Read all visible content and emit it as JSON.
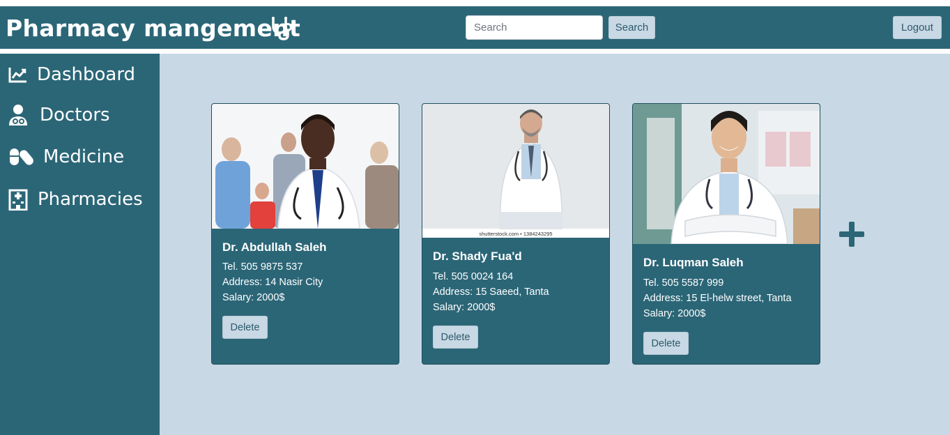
{
  "header": {
    "title": "Pharmacy mangement",
    "brand_icon": "stethoscope-icon",
    "search": {
      "placeholder": "Search",
      "value": ""
    },
    "search_button": "Search",
    "logout_button": "Logout"
  },
  "sidebar": {
    "items": [
      {
        "label": "Dashboard",
        "icon": "chart-line-icon"
      },
      {
        "label": "Doctors",
        "icon": "user-doctor-icon"
      },
      {
        "label": "Medicine",
        "icon": "pills-icon"
      },
      {
        "label": "Pharmacies",
        "icon": "hospital-icon"
      }
    ]
  },
  "doctors": [
    {
      "name": "Dr. Abdullah Saleh",
      "tel": "Tel. 505 9875 537",
      "address": "Address: 14 Nasir City",
      "salary": "Salary: 2000$",
      "delete_label": "Delete"
    },
    {
      "name": "Dr. Shady Fua'd",
      "tel": "Tel. 505 0024 164",
      "address": "Address: 15 Saeed, Tanta",
      "salary": "Salary: 2000$",
      "photo_caption": "shutterstock.com • 1384243295",
      "delete_label": "Delete"
    },
    {
      "name": "Dr. Luqman Saleh",
      "tel": "Tel. 505 5587 999",
      "address": "Address: 15 El-helw street, Tanta",
      "salary": "Salary: 2000$",
      "delete_label": "Delete"
    }
  ],
  "add_button_icon": "plus-icon",
  "colors": {
    "primary": "#2b6677",
    "background": "#c8d8e4",
    "button_light": "#c8d8e4",
    "text_on_primary": "#ffffff"
  }
}
